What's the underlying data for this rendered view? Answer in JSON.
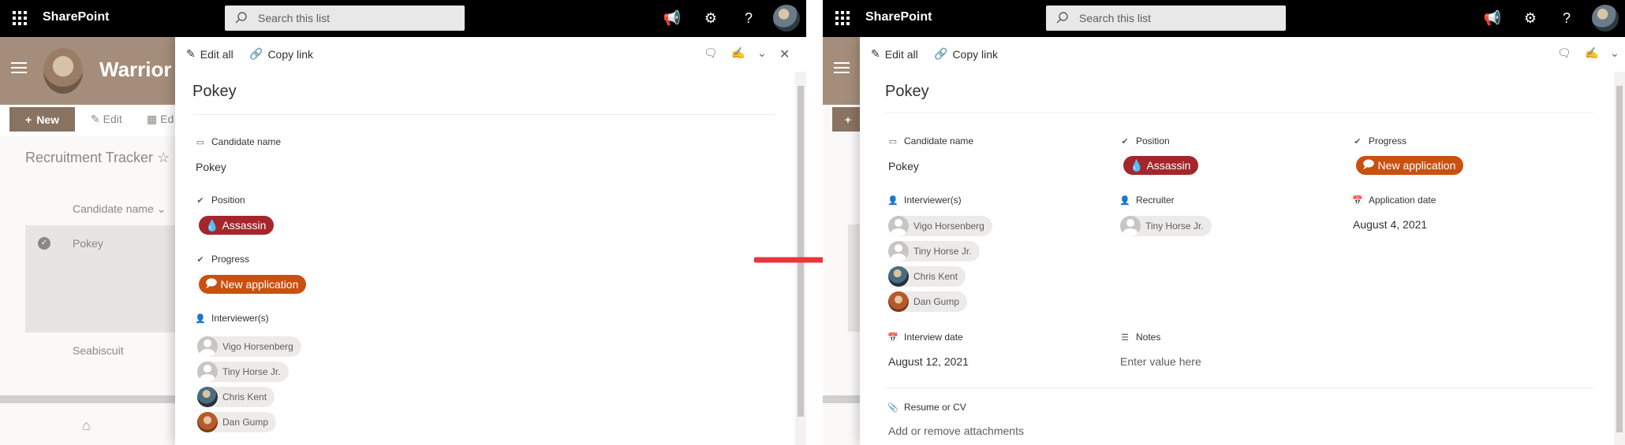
{
  "suite": {
    "waffle": "waffle-icon",
    "app_name": "SharePoint",
    "search_placeholder": "Search this list"
  },
  "site": {
    "title": "Warrior H",
    "new_label": "New",
    "edit_label": "Edit",
    "edit_grid_label": "Ed",
    "list_name": "Recruitment Tracker",
    "column_header": "Candidate name",
    "rows": [
      "Pokey",
      "Seabiscuit"
    ]
  },
  "panel": {
    "edit_all": "Edit all",
    "copy_link": "Copy link",
    "title": "Pokey",
    "fields": {
      "candidate_name": {
        "label": "Candidate name",
        "value": "Pokey"
      },
      "position": {
        "label": "Position",
        "value": "Assassin"
      },
      "progress": {
        "label": "Progress",
        "value": "New application"
      },
      "interviewers": {
        "label": "Interviewer(s)",
        "people": [
          "Vigo Horsenberg",
          "Tiny Horse Jr.",
          "Chris Kent",
          "Dan Gump"
        ]
      },
      "recruiter": {
        "label": "Recruiter",
        "people": [
          "Tiny Horse Jr."
        ]
      },
      "application_date": {
        "label": "Application date",
        "value": "August 4, 2021"
      },
      "interview_date": {
        "label": "Interview date",
        "value": "August 12, 2021"
      },
      "notes": {
        "label": "Notes",
        "placeholder": "Enter value here"
      },
      "resume": {
        "label": "Resume or CV",
        "placeholder": "Add or remove attachments"
      }
    }
  },
  "colors": {
    "position_pill": "#a4262c",
    "progress_pill": "#ca5010",
    "site_header": "#a48d7a",
    "arrow": "#e8363b"
  }
}
